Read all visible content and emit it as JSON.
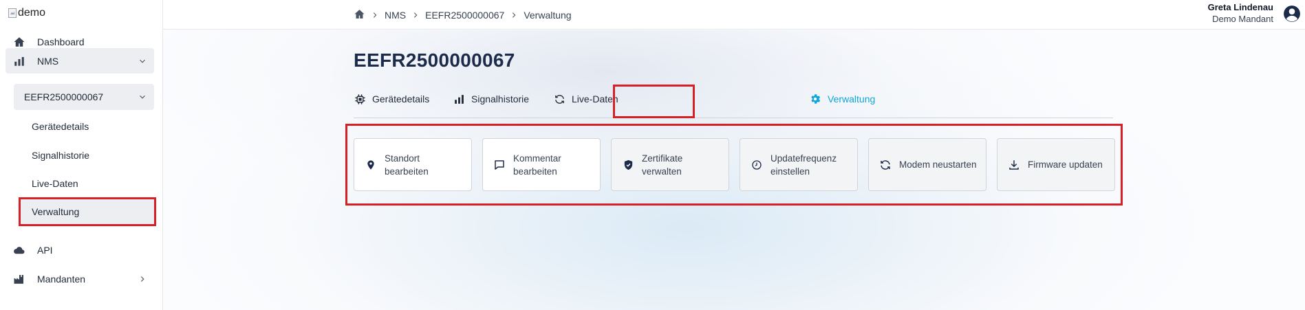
{
  "sidebar": {
    "logo_alt": "demo",
    "items": [
      {
        "label": "Dashboard",
        "icon": "home-icon"
      },
      {
        "label": "NMS",
        "icon": "bar-chart-icon"
      },
      {
        "label": "API",
        "icon": "cloud-icon"
      },
      {
        "label": "Mandanten",
        "icon": "factory-icon"
      }
    ],
    "nms_device": "EEFR2500000067",
    "device_children": [
      "Gerätedetails",
      "Signalhistorie",
      "Live-Daten",
      "Verwaltung"
    ]
  },
  "breadcrumb": {
    "home_icon": "home-icon",
    "items": [
      "NMS",
      "EEFR2500000067",
      "Verwaltung"
    ]
  },
  "user": {
    "name": "Greta Lindenau",
    "tenant": "Demo Mandant",
    "icon": "account-circle-icon"
  },
  "page": {
    "title": "EEFR2500000067",
    "tabs": [
      {
        "label": "Gerätedetails",
        "icon": "chip-icon"
      },
      {
        "label": "Signalhistorie",
        "icon": "signal-bars-icon"
      },
      {
        "label": "Live-Daten",
        "icon": "refresh-icon"
      },
      {
        "label": "Verwaltung",
        "icon": "gear-icon",
        "active": true
      }
    ],
    "actions": [
      {
        "label": "Standort\nbearbeiten",
        "icon": "location-pin-icon"
      },
      {
        "label": "Kommentar\nbearbeiten",
        "icon": "comment-icon"
      },
      {
        "label": "Zertifikate\nverwalten",
        "icon": "shield-check-icon"
      },
      {
        "label": "Updatefrequenz\neinstellen",
        "icon": "clock-icon"
      },
      {
        "label": "Modem neustarten",
        "icon": "refresh-icon"
      },
      {
        "label": "Firmware updaten",
        "icon": "download-icon"
      }
    ]
  },
  "colors": {
    "accent": "#0ea5d9",
    "highlight": "#d81f26",
    "title": "#1c2b4a"
  }
}
